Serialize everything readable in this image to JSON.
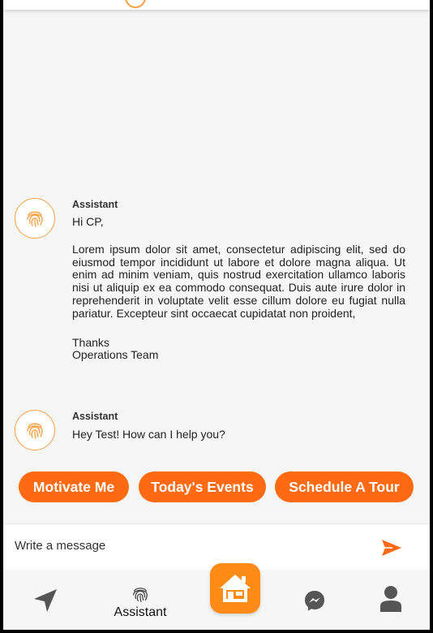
{
  "colors": {
    "accent": "#ff6a13",
    "home": "#ff8b17",
    "avatar_ring": "#f7a249",
    "icon_gray": "#555555"
  },
  "messages": [
    {
      "sender": "Assistant",
      "avatar_icon": "fingerprint-icon",
      "greeting": "Hi CP,",
      "paragraph": "Lorem ipsum dolor sit amet, consectetur adipiscing elit, sed do eiusmod tempor incididunt ut labore et dolore magna aliqua. Ut enim ad minim veniam, quis nostrud exercitation ullamco laboris nisi ut aliquip ex ea commodo consequat. Duis aute irure dolor in reprehenderit in voluptate velit esse cillum dolore eu fugiat nulla pariatur. Excepteur sint occaecat cupidatat non proident,",
      "signoff_1": "Thanks",
      "signoff_2": "Operations Team"
    },
    {
      "sender": "Assistant",
      "avatar_icon": "fingerprint-icon",
      "text": "Hey Test! How can I help you?"
    }
  ],
  "quick_replies": [
    {
      "label": "Motivate Me"
    },
    {
      "label": "Today's Events"
    },
    {
      "label": "Schedule A Tour"
    }
  ],
  "composer": {
    "placeholder": "Write a message",
    "send_icon": "send-icon"
  },
  "nav": {
    "items": [
      {
        "icon": "navigation-arrow-icon",
        "label": ""
      },
      {
        "icon": "fingerprint-icon",
        "label": "Assistant"
      },
      {
        "icon": "home-icon",
        "label": ""
      },
      {
        "icon": "messenger-icon",
        "label": ""
      },
      {
        "icon": "profile-icon",
        "label": ""
      }
    ]
  }
}
